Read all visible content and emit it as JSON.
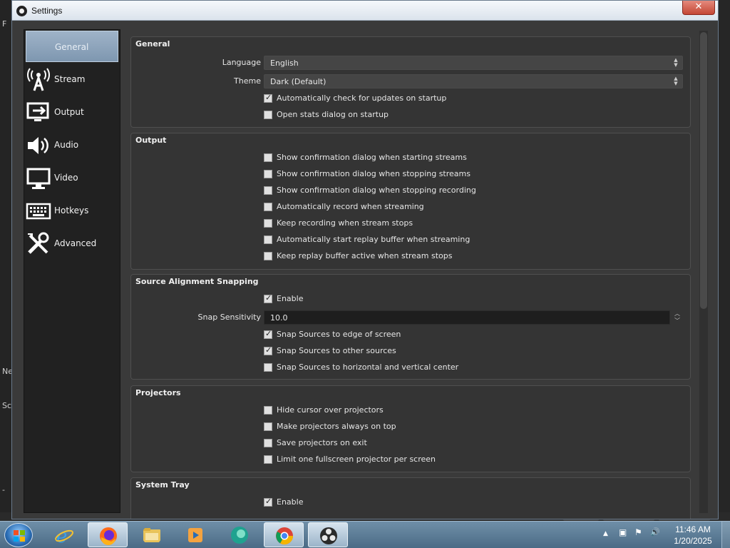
{
  "window": {
    "title": "Settings",
    "close_glyph": "✕"
  },
  "background": {
    "text_n": "Ne",
    "text_s": "Sc",
    "text_f": "F",
    "text_dash": "-"
  },
  "sidebar": {
    "items": [
      {
        "label": "General",
        "icon": "gear-icon",
        "selected": true
      },
      {
        "label": "Stream",
        "icon": "antenna-icon",
        "selected": false
      },
      {
        "label": "Output",
        "icon": "output-icon",
        "selected": false
      },
      {
        "label": "Audio",
        "icon": "speaker-icon",
        "selected": false
      },
      {
        "label": "Video",
        "icon": "monitor-icon",
        "selected": false
      },
      {
        "label": "Hotkeys",
        "icon": "keyboard-icon",
        "selected": false
      },
      {
        "label": "Advanced",
        "icon": "tools-icon",
        "selected": false
      }
    ]
  },
  "general": {
    "title": "General",
    "language_label": "Language",
    "language_value": "English",
    "theme_label": "Theme",
    "theme_value": "Dark (Default)",
    "check_updates": {
      "label": "Automatically check for updates on startup",
      "checked": true
    },
    "open_stats": {
      "label": "Open stats dialog on startup",
      "checked": false
    }
  },
  "output": {
    "title": "Output",
    "options": [
      {
        "label": "Show confirmation dialog when starting streams",
        "checked": false
      },
      {
        "label": "Show confirmation dialog when stopping streams",
        "checked": false
      },
      {
        "label": "Show confirmation dialog when stopping recording",
        "checked": false
      },
      {
        "label": "Automatically record when streaming",
        "checked": false
      },
      {
        "label": "Keep recording when stream stops",
        "checked": false
      },
      {
        "label": "Automatically start replay buffer when streaming",
        "checked": false
      },
      {
        "label": "Keep replay buffer active when stream stops",
        "checked": false
      }
    ]
  },
  "snapping": {
    "title": "Source Alignment Snapping",
    "enable": {
      "label": "Enable",
      "checked": true
    },
    "sensitivity_label": "Snap Sensitivity",
    "sensitivity_value": "10.0",
    "options": [
      {
        "label": "Snap Sources to edge of screen",
        "checked": true
      },
      {
        "label": "Snap Sources to other sources",
        "checked": true
      },
      {
        "label": "Snap Sources to horizontal and vertical center",
        "checked": false
      }
    ]
  },
  "projectors": {
    "title": "Projectors",
    "options": [
      {
        "label": "Hide cursor over projectors",
        "checked": false
      },
      {
        "label": "Make projectors always on top",
        "checked": false
      },
      {
        "label": "Save projectors on exit",
        "checked": false
      },
      {
        "label": "Limit one fullscreen projector per screen",
        "checked": false
      }
    ]
  },
  "system_tray": {
    "title": "System Tray",
    "enable": {
      "label": "Enable",
      "checked": true
    }
  },
  "taskbar": {
    "apps": [
      "internet-explorer-icon",
      "firefox-icon",
      "file-explorer-icon",
      "media-player-icon",
      "edge-icon",
      "chrome-icon",
      "obs-icon"
    ],
    "time": "11:46 AM",
    "date": "1/20/2025",
    "tray_glyphs": {
      "chevron": "▲",
      "network": "▣",
      "flag": "⚑",
      "volume": "🔊"
    }
  },
  "colors": {
    "window_bg": "#3a3a3a",
    "sidebar_bg": "#212121",
    "selected": "#8ea5bd",
    "taskbar": "#5a7a94"
  }
}
